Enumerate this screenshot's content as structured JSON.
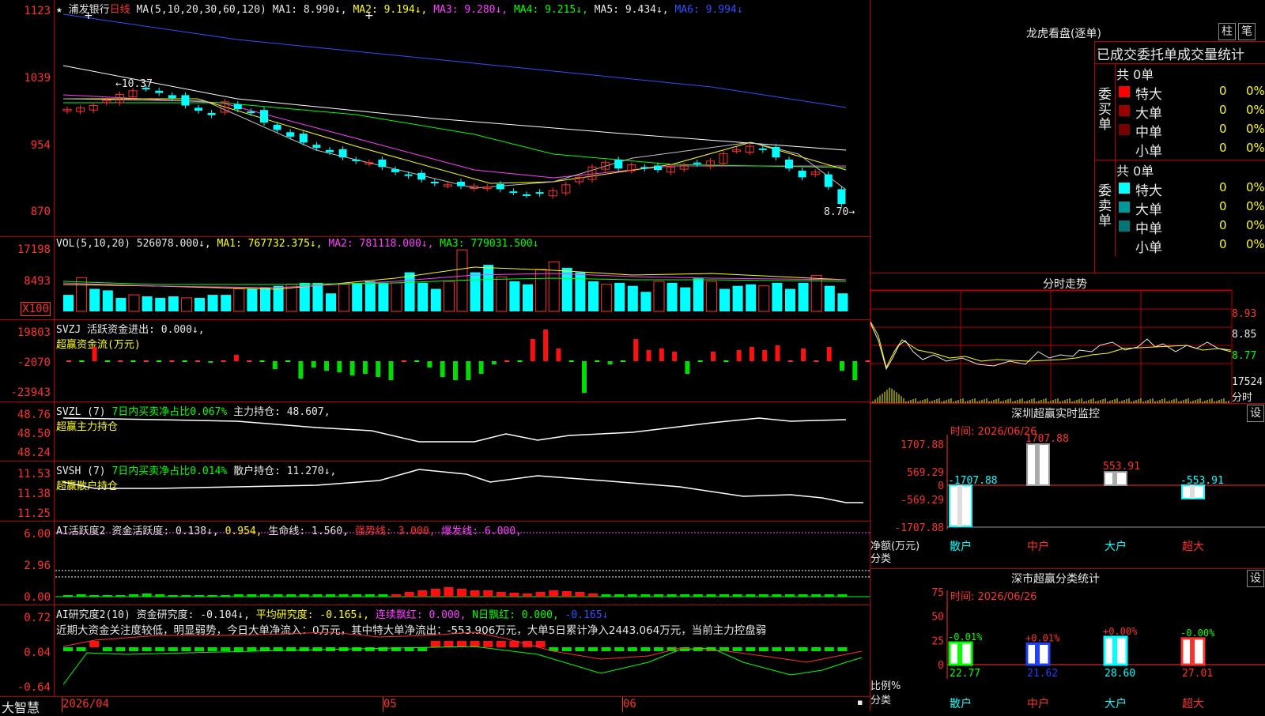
{
  "header": {
    "star": "★",
    "stock_name": "浦发银行",
    "period": "日线",
    "ma_label": "MA(5,10,20,30,60,120)",
    "ma1": "MA1: 8.990↓,",
    "ma2": "MA2: 9.194↓,",
    "ma3": "MA3: 9.280↓,",
    "ma4": "MA4: 9.215↓,",
    "ma5": "MA5: 9.434↓,",
    "ma6": "MA6: 9.994↓"
  },
  "price_axis": [
    "1123",
    "1039",
    "954",
    "870"
  ],
  "price_annotations": {
    "high": "10.37",
    "low": "8.70"
  },
  "vol": {
    "label": "VOL(5,10,20)",
    "value": "526078.000↓,",
    "ma1": "MA1: 767732.375↓,",
    "ma2": "MA2: 781118.000↓,",
    "ma3": "MA3: 779031.500↓",
    "axis": [
      "17198",
      "8493"
    ],
    "unit": "X100"
  },
  "svzj": {
    "label": "SVZJ",
    "active": "活跃资金进出: 0.000↓,",
    "name": "超赢资金流(万元)",
    "axis": [
      "19803",
      "-2070",
      "-23943"
    ]
  },
  "svzl": {
    "label": "SVZL (7)",
    "ratio": "7日内买卖净占比0.067%",
    "hold": "主力持仓: 48.607,",
    "name": "超赢主力持仓",
    "axis": [
      "48.76",
      "48.50",
      "48.24"
    ]
  },
  "svsh": {
    "label": "SVSH (7)",
    "ratio": "7日内买卖净占比0.014%",
    "hold": "散户持仓: 11.270↓,",
    "name": "超赢散户持仓",
    "axis": [
      "11.53",
      "11.38",
      "11.25"
    ]
  },
  "ai_act": {
    "label": "AI活跃度2",
    "act": "资金活跃度: 0.138↓,",
    "v2": "0.954,",
    "life": "生命线: 1.560,",
    "strong": "强势线: 3.000,",
    "burst": "爆发线: 6.000,",
    "axis": [
      "6.00",
      "2.96",
      "0.00"
    ]
  },
  "ai_res": {
    "label": "AI研究度2(10)",
    "res": "资金研究度: -0.104↓,",
    "avg": "平均研究度: -0.165↓,",
    "lianxu": "连续飘红: 0.000,",
    "nday": "N日飘红: 0.000,",
    "last": "-0.165↓",
    "comment": "近期大资金关注度较低，明显弱势，今日大单净流入：0万元，其中特大单净流出：-553.906万元，大单5日累计净入2443.064万元，当前主力控盘弱",
    "axis": [
      "0.72",
      "0.04",
      "-0.64"
    ]
  },
  "footer": {
    "brand": "大智慧",
    "date1": "2026/04",
    "date2": "05",
    "date3": "06"
  },
  "lhb": {
    "title": "龙虎看盘(逐单)",
    "btn1": "柱",
    "btn2": "笔",
    "subtitle": "已成交委托单成交量统计",
    "buy_label": "委买单",
    "sell_label": "委卖单",
    "buy_total": "共 0单",
    "sell_total": "共 0单",
    "rows": [
      {
        "name": "特大",
        "count": "0",
        "pct": "0%"
      },
      {
        "name": "大单",
        "count": "0",
        "pct": "0%"
      },
      {
        "name": "中单",
        "count": "0",
        "pct": "0%"
      },
      {
        "name": "小单",
        "count": "0",
        "pct": "0%"
      }
    ]
  },
  "intraday": {
    "title": "分时走势",
    "axis": [
      "8.93",
      "8.85",
      "8.77",
      "17524"
    ],
    "unit": "分时"
  },
  "sz_monitor": {
    "title": "深圳超赢实时监控",
    "btn": "设",
    "time": "时间: 2026/06/26",
    "axis": [
      "1707.88",
      "569.29",
      "0",
      "-569.29",
      "-1707.88"
    ],
    "net_label": "净额(万元)",
    "cat_label": "分类",
    "bars": [
      {
        "cat": "散户",
        "label": "-1707.88",
        "value": -1707.88
      },
      {
        "cat": "中户",
        "label": "1707.88",
        "value": 1707.88
      },
      {
        "cat": "大户",
        "label": "553.91",
        "value": 553.91
      },
      {
        "cat": "超大",
        "label": "-553.91",
        "value": -553.91
      }
    ]
  },
  "sz_stats": {
    "title": "深市超赢分类统计",
    "btn": "设",
    "time": "时间: 2026/06/26",
    "axis": [
      "75",
      "50",
      "25",
      "0"
    ],
    "ratio_label": "比例%",
    "cat_label": "分类",
    "bars": [
      {
        "cat": "散户",
        "change": "-0.01%",
        "value": 22.77,
        "label": "22.77"
      },
      {
        "cat": "中户",
        "change": "+0.01%",
        "value": 21.62,
        "label": "21.62"
      },
      {
        "cat": "大户",
        "change": "+0.00%",
        "value": 28.6,
        "label": "28.60"
      },
      {
        "cat": "超大",
        "change": "-0.00%",
        "value": 27.01,
        "label": "27.01"
      }
    ]
  }
}
